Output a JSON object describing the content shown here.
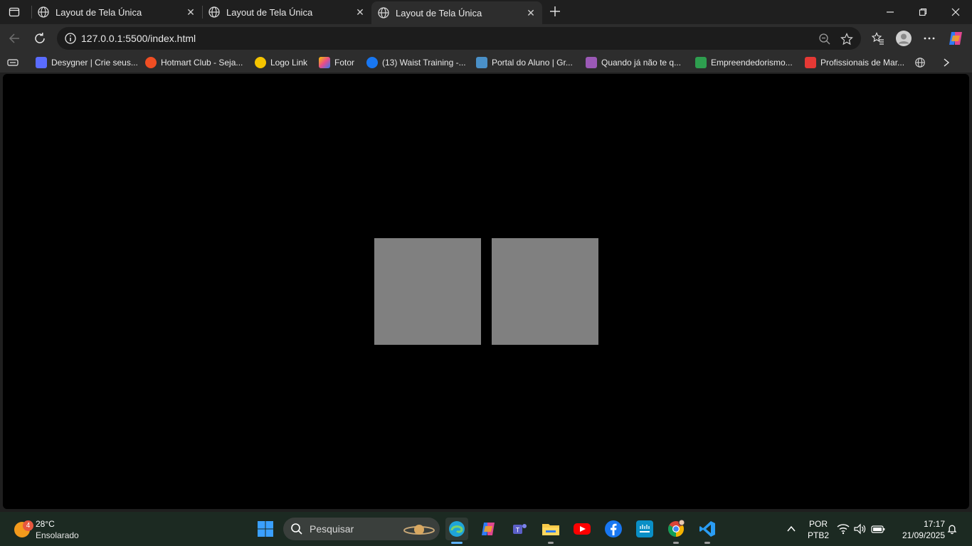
{
  "browser": {
    "tabs": [
      {
        "title": "Layout de Tela Única",
        "active": false
      },
      {
        "title": "Layout de Tela Única",
        "active": false
      },
      {
        "title": "Layout de Tela Única",
        "active": true
      }
    ],
    "url": "127.0.0.1:5500/index.html"
  },
  "bookmarks": [
    {
      "label": "Desygner | Crie seus...",
      "color": "#5a6cff"
    },
    {
      "label": "Hotmart Club - Seja...",
      "color": "#f04e23"
    },
    {
      "label": "Logo Link",
      "color": "#f5c400"
    },
    {
      "label": "Fotor",
      "color": "#e94b8a"
    },
    {
      "label": "(13) Waist Training -...",
      "color": "#1877f2"
    },
    {
      "label": "Portal do Aluno | Gr...",
      "color": "#4a90c8"
    },
    {
      "label": "Quando já não te q...",
      "color": "#9b59b6"
    },
    {
      "label": "Empreendedorismo...",
      "color": "#2e9e4f"
    },
    {
      "label": "Profissionais de Mar...",
      "color": "#e53935"
    }
  ],
  "page": {
    "background": "#000000",
    "box_color": "#808080"
  },
  "taskbar": {
    "weather": {
      "badge": "4",
      "temp": "28°C",
      "condition": "Ensolarado"
    },
    "search_placeholder": "Pesquisar",
    "language": "POR",
    "layout": "PTB2",
    "time": "17:17",
    "date": "21/09/2025"
  }
}
